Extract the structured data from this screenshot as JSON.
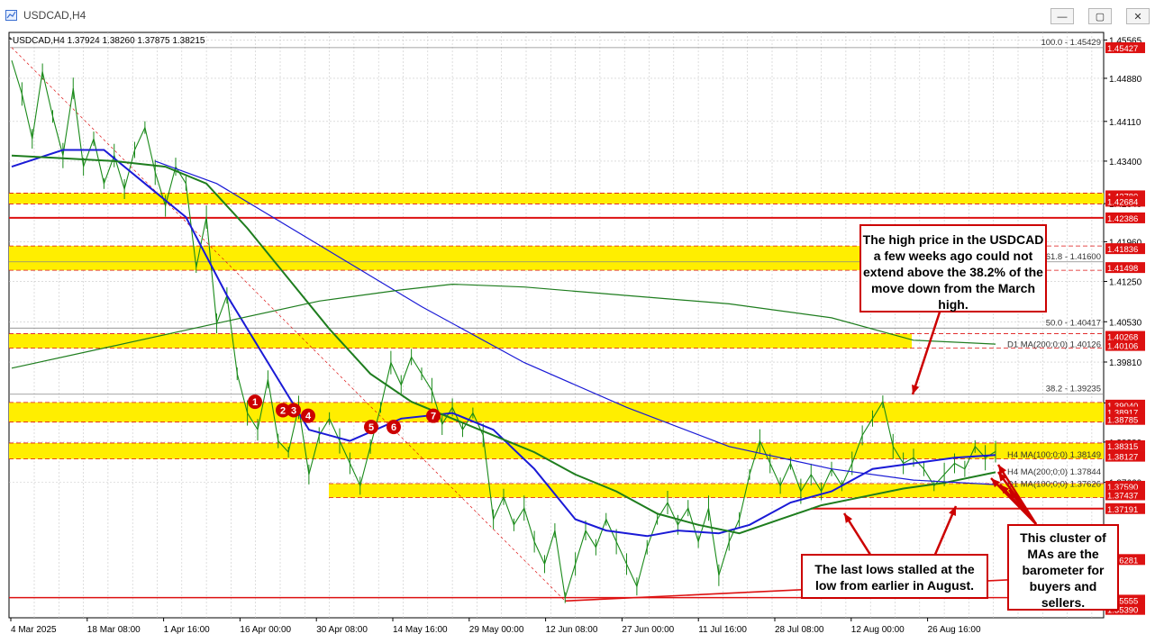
{
  "window": {
    "title": "USDCAD,H4",
    "minimize": "—",
    "restore": "▢",
    "close": "✕"
  },
  "header": {
    "symbol": "USDCAD,H4",
    "ohlc": "1.37924 1.38260 1.37875 1.38215"
  },
  "colors": {
    "candles": "#1a8a1a",
    "ma_blue": "#1a1ad6",
    "ma_green": "#1e7d1e",
    "zone_yellow": "#ffee00",
    "line_red": "#dd1111",
    "annotation_red": "#cc0000",
    "grid": "#c8c8c8"
  },
  "chart_data": {
    "type": "line",
    "title": "USDCAD,H4",
    "ylim": [
      1.3524,
      1.457
    ],
    "yticks": [
      1.45565,
      1.4488,
      1.4411,
      1.434,
      1.4264,
      1.4196,
      1.4125,
      1.4053,
      1.3981,
      1.3908,
      1.3838,
      1.3766
    ],
    "xticks": [
      "4 Mar 2025",
      "18 Mar 08:00",
      "1 Apr 16:00",
      "16 Apr 00:00",
      "30 Apr 08:00",
      "14 May 16:00",
      "29 May 00:00",
      "12 Jun 08:00",
      "27 Jun 00:00",
      "11 Jul 16:00",
      "28 Jul 08:00",
      "12 Aug 00:00",
      "26 Aug 16:00"
    ],
    "x_dates": [
      "2025-03-04",
      "2025-03-18",
      "2025-04-01",
      "2025-04-16",
      "2025-04-30",
      "2025-05-14",
      "2025-05-29",
      "2025-06-12",
      "2025-06-27",
      "2025-07-11",
      "2025-07-28",
      "2025-08-12",
      "2025-08-26"
    ],
    "price_series": [
      [
        0,
        1.452
      ],
      [
        1,
        1.446
      ],
      [
        2,
        1.438
      ],
      [
        3,
        1.45
      ],
      [
        4,
        1.442
      ],
      [
        5,
        1.435
      ],
      [
        6,
        1.447
      ],
      [
        7,
        1.433
      ],
      [
        8,
        1.438
      ],
      [
        9,
        1.43
      ],
      [
        10,
        1.435
      ],
      [
        11,
        1.429
      ],
      [
        12,
        1.436
      ],
      [
        13,
        1.44
      ],
      [
        14,
        1.432
      ],
      [
        15,
        1.426
      ],
      [
        16,
        1.433
      ],
      [
        17,
        1.43
      ],
      [
        18,
        1.415
      ],
      [
        19,
        1.424
      ],
      [
        20,
        1.405
      ],
      [
        21,
        1.41
      ],
      [
        22,
        1.396
      ],
      [
        23,
        1.389
      ],
      [
        24,
        1.386
      ],
      [
        25,
        1.395
      ],
      [
        26,
        1.384
      ],
      [
        27,
        1.382
      ],
      [
        28,
        1.39
      ],
      [
        29,
        1.378
      ],
      [
        30,
        1.385
      ],
      [
        31,
        1.388
      ],
      [
        32,
        1.384
      ],
      [
        33,
        1.38
      ],
      [
        34,
        1.376
      ],
      [
        35,
        1.383
      ],
      [
        36,
        1.39
      ],
      [
        37,
        1.398
      ],
      [
        38,
        1.394
      ],
      [
        39,
        1.399
      ],
      [
        40,
        1.396
      ],
      [
        41,
        1.393
      ],
      [
        42,
        1.387
      ],
      [
        43,
        1.39
      ],
      [
        44,
        1.386
      ],
      [
        45,
        1.389
      ],
      [
        46,
        1.385
      ],
      [
        47,
        1.37
      ],
      [
        48,
        1.374
      ],
      [
        49,
        1.369
      ],
      [
        50,
        1.372
      ],
      [
        51,
        1.366
      ],
      [
        52,
        1.362
      ],
      [
        53,
        1.368
      ],
      [
        54,
        1.356
      ],
      [
        55,
        1.362
      ],
      [
        56,
        1.368
      ],
      [
        57,
        1.365
      ],
      [
        58,
        1.37
      ],
      [
        59,
        1.366
      ],
      [
        60,
        1.362
      ],
      [
        61,
        1.358
      ],
      [
        62,
        1.365
      ],
      [
        63,
        1.37
      ],
      [
        64,
        1.373
      ],
      [
        65,
        1.369
      ],
      [
        66,
        1.372
      ],
      [
        67,
        1.366
      ],
      [
        68,
        1.372
      ],
      [
        69,
        1.36
      ],
      [
        70,
        1.366
      ],
      [
        71,
        1.37
      ],
      [
        72,
        1.378
      ],
      [
        73,
        1.384
      ],
      [
        74,
        1.38
      ],
      [
        75,
        1.376
      ],
      [
        76,
        1.38
      ],
      [
        77,
        1.375
      ],
      [
        78,
        1.378
      ],
      [
        79,
        1.375
      ],
      [
        80,
        1.379
      ],
      [
        81,
        1.376
      ],
      [
        82,
        1.38
      ],
      [
        83,
        1.385
      ],
      [
        84,
        1.388
      ],
      [
        85,
        1.391
      ],
      [
        86,
        1.383
      ],
      [
        87,
        1.38
      ],
      [
        88,
        1.381
      ],
      [
        89,
        1.379
      ],
      [
        90,
        1.376
      ],
      [
        91,
        1.378
      ],
      [
        92,
        1.38
      ],
      [
        93,
        1.379
      ],
      [
        94,
        1.383
      ],
      [
        95,
        1.381
      ],
      [
        96,
        1.3821
      ]
    ],
    "series": [
      {
        "name": "H4 MA(100;0;0)",
        "values": [
          [
            0,
            1.433
          ],
          [
            5,
            1.436
          ],
          [
            9,
            1.436
          ],
          [
            13,
            1.43
          ],
          [
            17,
            1.424
          ],
          [
            21,
            1.41
          ],
          [
            25,
            1.398
          ],
          [
            29,
            1.386
          ],
          [
            33,
            1.384
          ],
          [
            38,
            1.388
          ],
          [
            43,
            1.389
          ],
          [
            47,
            1.386
          ],
          [
            51,
            1.379
          ],
          [
            55,
            1.37
          ],
          [
            58,
            1.368
          ],
          [
            62,
            1.367
          ],
          [
            65,
            1.368
          ],
          [
            69,
            1.3675
          ],
          [
            72,
            1.369
          ],
          [
            76,
            1.373
          ],
          [
            80,
            1.375
          ],
          [
            84,
            1.379
          ],
          [
            88,
            1.38
          ],
          [
            92,
            1.381
          ],
          [
            96,
            1.3815
          ]
        ]
      },
      {
        "name": "H4 MA(200;0;0)",
        "values": [
          [
            0,
            1.435
          ],
          [
            5,
            1.4345
          ],
          [
            10,
            1.434
          ],
          [
            15,
            1.433
          ],
          [
            19,
            1.43
          ],
          [
            23,
            1.422
          ],
          [
            27,
            1.413
          ],
          [
            31,
            1.404
          ],
          [
            35,
            1.396
          ],
          [
            39,
            1.391
          ],
          [
            43,
            1.388
          ],
          [
            47,
            1.385
          ],
          [
            51,
            1.382
          ],
          [
            55,
            1.378
          ],
          [
            59,
            1.375
          ],
          [
            63,
            1.371
          ],
          [
            67,
            1.369
          ],
          [
            71,
            1.3675
          ],
          [
            75,
            1.37
          ],
          [
            79,
            1.3725
          ],
          [
            83,
            1.374
          ],
          [
            87,
            1.3755
          ],
          [
            91,
            1.3765
          ],
          [
            96,
            1.3784
          ]
        ]
      },
      {
        "name": "D1 MA(100;0;0)",
        "values": [
          [
            14,
            1.434
          ],
          [
            20,
            1.43
          ],
          [
            30,
            1.419
          ],
          [
            40,
            1.408
          ],
          [
            50,
            1.398
          ],
          [
            60,
            1.39
          ],
          [
            70,
            1.383
          ],
          [
            80,
            1.379
          ],
          [
            88,
            1.377
          ],
          [
            96,
            1.3762
          ]
        ]
      },
      {
        "name": "D1 MA(200;0;0)",
        "values": [
          [
            0,
            1.397
          ],
          [
            10,
            1.401
          ],
          [
            20,
            1.405
          ],
          [
            30,
            1.409
          ],
          [
            38,
            1.411
          ],
          [
            43,
            1.412
          ],
          [
            50,
            1.4115
          ],
          [
            60,
            1.41
          ],
          [
            70,
            1.4085
          ],
          [
            80,
            1.406
          ],
          [
            88,
            1.402
          ],
          [
            96,
            1.4013
          ]
        ]
      }
    ],
    "horizontal_lines": [
      {
        "label": "100.0 - 1.45429",
        "value": 1.45429
      },
      {
        "label": "61.8 - 1.41600",
        "value": 1.416
      },
      {
        "label": "50.0 - 1.40417",
        "value": 1.40417
      },
      {
        "label": "38.2 - 1.39235",
        "value": 1.39235
      },
      {
        "label": "",
        "value": 1.42386
      },
      {
        "label": "",
        "value": 1.37191
      }
    ],
    "zones": [
      {
        "low": 1.42684,
        "high": 1.4278
      },
      {
        "low": 1.41498,
        "high": 1.41836
      },
      {
        "low": 1.40106,
        "high": 1.40268
      },
      {
        "low": 1.38785,
        "high": 1.3904
      },
      {
        "low": 1.38127,
        "high": 1.38315
      },
      {
        "low": 1.37437,
        "high": 1.3759
      }
    ],
    "right_axis_labels": [
      "1.45427",
      "1.42780",
      "1.42684",
      "1.42386",
      "1.41836",
      "1.41498",
      "1.40268",
      "1.40106",
      "1.39040",
      "1.38917",
      "1.38785",
      "1.38315",
      "1.38127",
      "1.37590",
      "1.37437",
      "1.37191",
      "1.36281",
      "1.35555",
      "1.35390"
    ],
    "ma_labels": [
      "D1 MA(200;0;0) 1.40126",
      "H4 MA(100;0;0) 1.38149",
      "H4 MA(200;0;0) 1.37844",
      "D1 MA(100;0;0) 1.37626"
    ],
    "markers": [
      "1",
      "2",
      "3",
      "4",
      "5",
      "6",
      "7"
    ],
    "annotations": [
      "The high price in the USDCAD a few weeks ago could not extend above the 38.2% of the move down from the March high.",
      "The last lows stalled at the low from earlier in August.",
      "This cluster of MAs are the barometer for buyers and sellers."
    ]
  }
}
